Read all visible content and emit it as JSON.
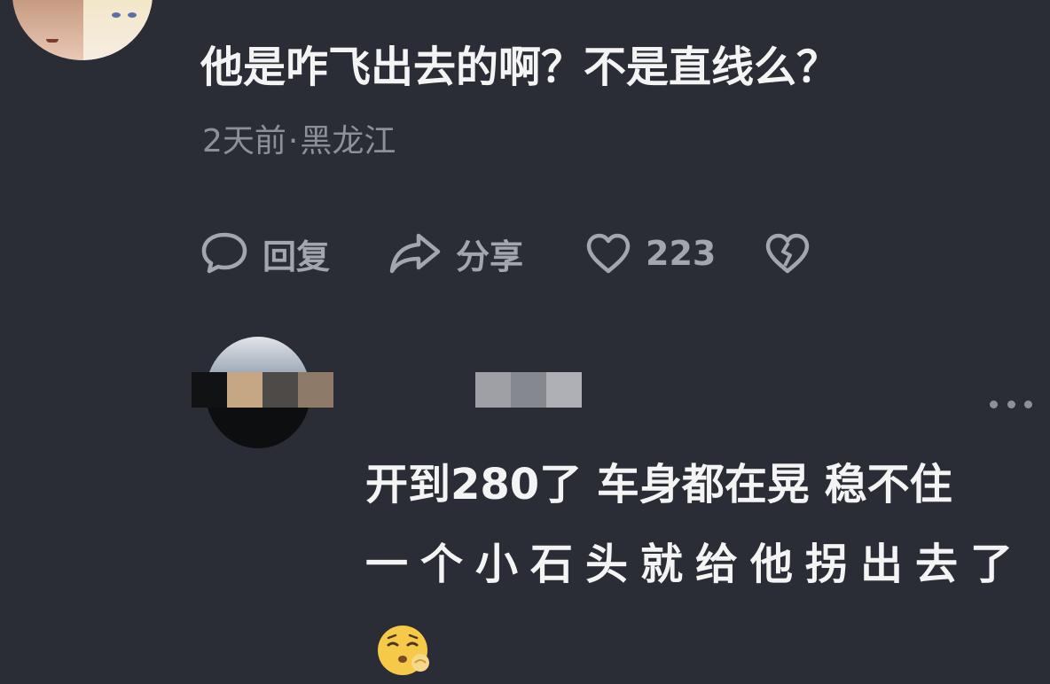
{
  "comments": [
    {
      "text": "他是咋飞出去的啊？不是直线么？",
      "time": "2天前",
      "location": "黑龙江",
      "actions": {
        "reply": "回复",
        "share": "分享",
        "likes": "223"
      }
    },
    {
      "line1": "开到280了 车身都在晃 稳不住",
      "line2": "一个小石头就给他拐出去了"
    }
  ],
  "colors": {
    "background": "#2a2d35",
    "text_primary": "#f4f4f4",
    "text_secondary": "#8e9099",
    "icon": "#a4a6ae"
  },
  "icons": [
    "comment-bubble-icon",
    "share-arrow-icon",
    "heart-icon",
    "broken-heart-icon",
    "more-dots-icon",
    "emoji-icon"
  ]
}
